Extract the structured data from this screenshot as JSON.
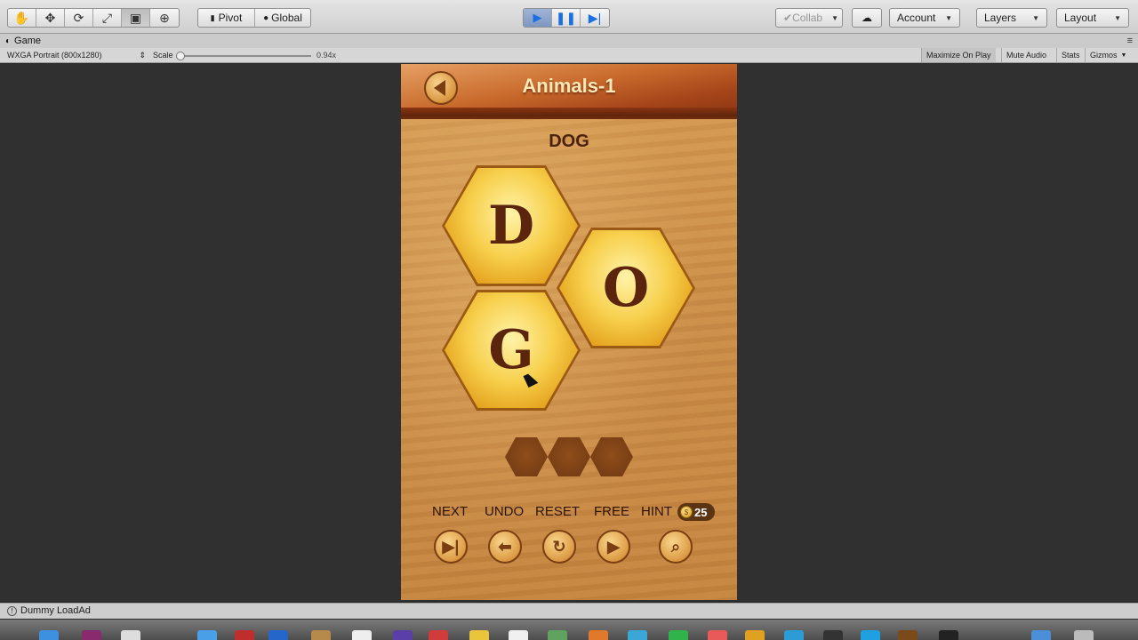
{
  "toolbar": {
    "transform_tools": [
      "hand-icon",
      "move-icon",
      "rotate-icon",
      "scale-icon",
      "rect-icon",
      "transform-icon"
    ],
    "pivot_label": "Pivot",
    "global_label": "Global",
    "collab_label": "Collab",
    "account_label": "Account",
    "layers_label": "Layers",
    "layout_label": "Layout"
  },
  "tab": {
    "title": "Game"
  },
  "game_bar": {
    "resolution": "WXGA Portrait (800x1280)",
    "scale_label": "Scale",
    "scale_value": "0.94x",
    "maximize_label": "Maximize On Play",
    "mute_label": "Mute Audio",
    "stats_label": "Stats",
    "gizmos_label": "Gizmos"
  },
  "game": {
    "level_title": "Animals-1",
    "target_word": "DOG",
    "tiles": [
      "D",
      "O",
      "G"
    ],
    "slot_count": 3,
    "controls": [
      {
        "label": "NEXT",
        "icon": "next-icon"
      },
      {
        "label": "UNDO",
        "icon": "undo-icon"
      },
      {
        "label": "RESET",
        "icon": "reset-icon"
      },
      {
        "label": "FREE",
        "icon": "video-icon"
      },
      {
        "label": "HINT",
        "icon": "magnifier-icon"
      }
    ],
    "coins": "25"
  },
  "status": {
    "message": "Dummy LoadAd"
  },
  "colors": {
    "header_wood": "#c86a2c",
    "board_wood": "#d59a52",
    "tile_gold": "#f7cf4b",
    "letter_brown": "#5a250c"
  }
}
